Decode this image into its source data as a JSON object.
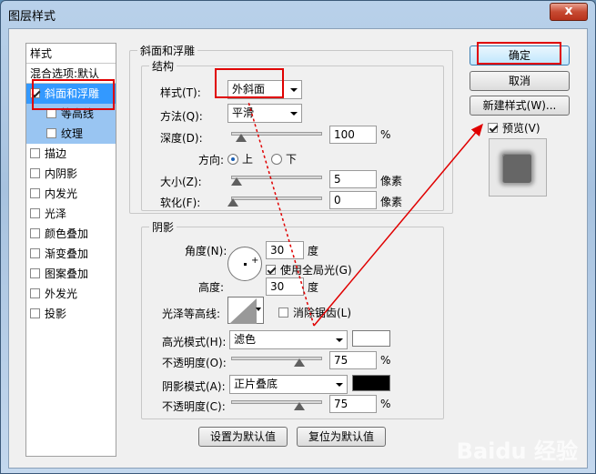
{
  "window": {
    "title": "图层样式",
    "close_label": "x"
  },
  "style_list": {
    "header": "样式",
    "blend_options": "混合选项:默认",
    "items": [
      {
        "label": "斜面和浮雕",
        "checked": true,
        "selected": true
      },
      {
        "label": "等高线",
        "checked": false,
        "sub": true
      },
      {
        "label": "纹理",
        "checked": false,
        "sub": true
      },
      {
        "label": "描边",
        "checked": false
      },
      {
        "label": "内阴影",
        "checked": false
      },
      {
        "label": "内发光",
        "checked": false
      },
      {
        "label": "光泽",
        "checked": false
      },
      {
        "label": "颜色叠加",
        "checked": false
      },
      {
        "label": "渐变叠加",
        "checked": false
      },
      {
        "label": "图案叠加",
        "checked": false
      },
      {
        "label": "外发光",
        "checked": false
      },
      {
        "label": "投影",
        "checked": false
      }
    ]
  },
  "bevel": {
    "group_title": "斜面和浮雕",
    "structure_title": "结构",
    "style_label": "样式(T):",
    "style_value": "外斜面",
    "technique_label": "方法(Q):",
    "technique_value": "平滑",
    "depth_label": "深度(D):",
    "depth_value": "100",
    "depth_unit": "%",
    "direction_label": "方向:",
    "dir_up": "上",
    "dir_down": "下",
    "size_label": "大小(Z):",
    "size_value": "5",
    "size_unit": "像素",
    "soften_label": "软化(F):",
    "soften_value": "0",
    "soften_unit": "像素"
  },
  "shading": {
    "title": "阴影",
    "angle_label": "角度(N):",
    "angle_value": "30",
    "angle_unit": "度",
    "global_light_label": "使用全局光(G)",
    "altitude_label": "高度:",
    "altitude_value": "30",
    "altitude_unit": "度",
    "gloss_contour_label": "光泽等高线:",
    "antialias_label": "消除锯齿(L)",
    "highlight_mode_label": "高光模式(H):",
    "highlight_mode_value": "滤色",
    "highlight_color": "#ffffff",
    "highlight_opacity_label": "不透明度(O):",
    "highlight_opacity_value": "75",
    "shadow_mode_label": "阴影模式(A):",
    "shadow_mode_value": "正片叠底",
    "shadow_color": "#000000",
    "shadow_opacity_label": "不透明度(C):",
    "shadow_opacity_value": "75",
    "pct": "%"
  },
  "buttons": {
    "make_default": "设置为默认值",
    "reset_default": "复位为默认值",
    "ok": "确定",
    "cancel": "取消",
    "new_style": "新建样式(W)...",
    "preview": "预览(V)"
  },
  "watermark": "Baidu 经验",
  "colors": {
    "annotation_red": "#e00000",
    "selection_blue": "#3399ff"
  }
}
